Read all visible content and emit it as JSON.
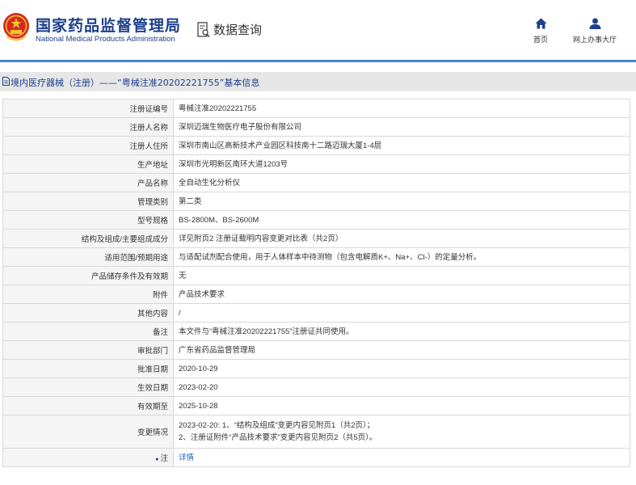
{
  "header": {
    "title_cn": "国家药品监督管理局",
    "title_en": "National Medical Products Administration",
    "query_label": "数据查询",
    "nav": [
      {
        "label": "首页",
        "icon": "home-icon"
      },
      {
        "label": "网上办事大厅",
        "icon": "user-icon"
      }
    ]
  },
  "section": {
    "title": "境内医疗器械（注册）——“粤械注准20202221755”基本信息"
  },
  "colors": {
    "brand": "#1e3f8c",
    "accent_line": "#4a86c8",
    "label_bg": "#f5f5f5",
    "link": "#1d5fb3"
  },
  "rows": [
    {
      "label": "注册证编号",
      "value": "粤械注准20202221755"
    },
    {
      "label": "注册人名称",
      "value": "深圳迈瑞生物医疗电子股份有限公司"
    },
    {
      "label": "注册人住所",
      "value": "深圳市南山区高新技术产业园区科技南十二路迈瑞大厦1-4层"
    },
    {
      "label": "生产地址",
      "value": "深圳市光明新区南环大道1203号"
    },
    {
      "label": "产品名称",
      "value": "全自动生化分析仪"
    },
    {
      "label": "管理类别",
      "value": "第二类"
    },
    {
      "label": "型号规格",
      "value": "BS-2800M、BS-2600M"
    },
    {
      "label": "结构及组成/主要组成成分",
      "value": "详见附页2 注册证载明内容变更对比表（共2页）"
    },
    {
      "label": "适用范围/预期用途",
      "value": "与适配试剂配合使用，用于人体样本中待测物（包含电解质K+、Na+、Cl-）的定量分析。"
    },
    {
      "label": "产品储存条件及有效期",
      "value": "无"
    },
    {
      "label": "附件",
      "value": "产品技术要求"
    },
    {
      "label": "其他内容",
      "value": "/"
    },
    {
      "label": "备注",
      "value": "本文件与“粤械注准20202221755”注册证共同使用。"
    },
    {
      "label": "审批部门",
      "value": "广东省药品监督管理局"
    },
    {
      "label": "批准日期",
      "value": "2020-10-29"
    },
    {
      "label": "生效日期",
      "value": "2023-02-20"
    },
    {
      "label": "有效期至",
      "value": "2025-10-28"
    }
  ],
  "change_row": {
    "label": "变更情况",
    "lines": [
      "2023-02-20: 1、“结构及组成”变更内容见附页1（共2页）；",
      "2、注册证附件“产品技术要求”变更内容见附页2（共5页）。"
    ]
  },
  "note_row": {
    "label": "注",
    "icon": "note-icon",
    "link": "详情"
  }
}
